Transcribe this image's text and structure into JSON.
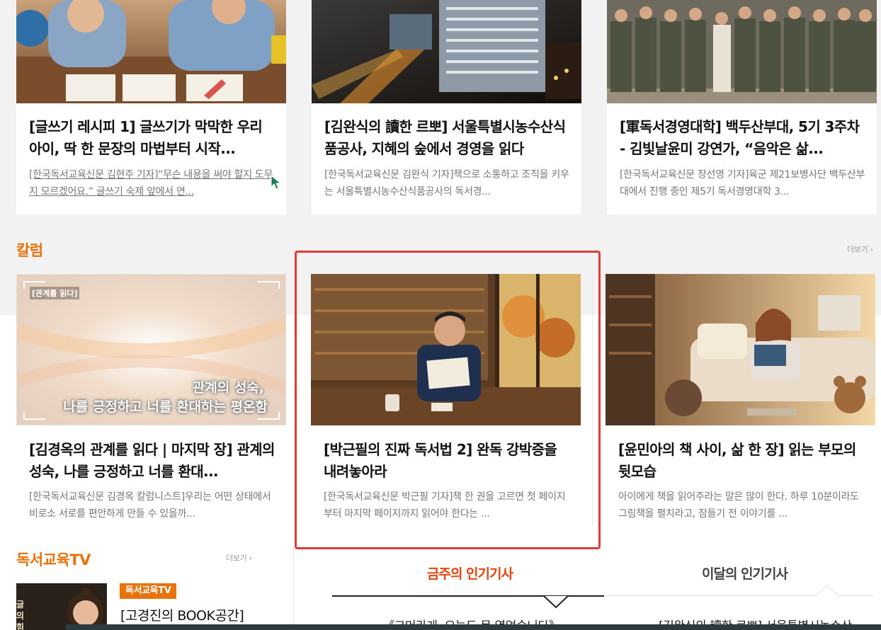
{
  "top_cards": [
    {
      "title": "[글쓰기 레시피 1] 글쓰기가 막막한 우리 아이, 딱 한 문장의 마법부터 시작...",
      "summary": "[한국독서교육신문 김현주 기자]“무슨 내용을 써야 할지 도무지 모르겠어요.” 글쓰기 숙제 앞에서 연..."
    },
    {
      "title": "[김완식의 讀한 르뽀] 서울특별시농수산식품공사, 지혜의 숲에서 경영을 읽다",
      "summary": "[한국독서교육신문 김완식 기자]책으로 소통하고 조직을 키우는 서울특별시농수산식품공사의 독서경..."
    },
    {
      "title": "[軍독서경영대학] 백두산부대, 5기 3주차 - 김빛날윤미 강연가, “음악은 삶...",
      "summary": "[한국독서교육신문 장선영 기자]육군 제21보병사단 백두산부대에서 진행 중인 제5기 독서경영대학 3..."
    }
  ],
  "column_section": {
    "title": "칼럼",
    "more": "더보기 ›",
    "cards": [
      {
        "thumb_tag": "[관계를 읽다]",
        "thumb_caption_line1": "관계의 성숙,",
        "thumb_caption_line2": "나를 긍정하고 너를 환대하는 평온함",
        "title": "[김경옥의 관계를 읽다 | 마지막 장] 관계의 성숙, 나를 긍정하고 너를 환대...",
        "summary": "[한국독서교육신문 김경옥 칼럼니스트]우리는 어떤 상태에서 비로소 서로를 편안하게 만들 수 있을까..."
      },
      {
        "title": "[박근필의 진짜 독서법 2] 완독 강박증을 내려놓아라",
        "summary": "[한국독서교육신문 박근필 기자]책 한 권을 고르면 첫 페이지부터 마지막 페이지까지 읽어야 한다는 ..."
      },
      {
        "title": "[윤민아의 책 사이, 삶 한 장] 읽는 부모의 뒷모습",
        "summary": "아이에게 책을 읽어주라는 말은 많이 한다. 하루 10분이라도 그림책을 펼치라고, 잠들기 전 이야기를 ..."
      }
    ]
  },
  "tv_section": {
    "title": "독서교육TV",
    "more": "더보기 ›",
    "badge": "독서교육TV",
    "item_title": "[고경진의 BOOK공간]",
    "thumb_text": "글의 힘"
  },
  "popular": {
    "tab_week": "금주의 인기기사",
    "tab_month": "이달의 인기기사",
    "item_left": "《크머라게, 오늘도 문 열었습니다》",
    "item_right": "[김완식의 讀한 르뽀] 서울특별시농수산"
  },
  "colors": {
    "accent": "#e8730c",
    "highlight": "#e53935",
    "tab_active": "#e8430c"
  }
}
